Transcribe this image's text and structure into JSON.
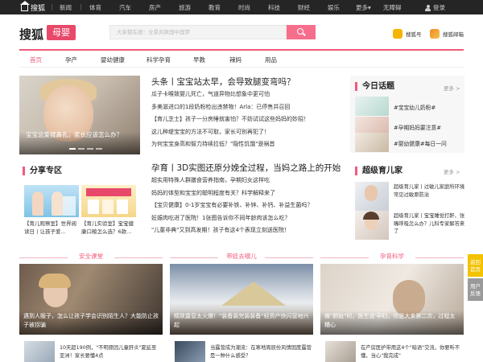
{
  "topbar": {
    "logo": "搜狐",
    "nav": [
      "新闻",
      "体育",
      "汽车",
      "房产",
      "旅游",
      "教育",
      "时尚",
      "科技",
      "财经",
      "娱乐",
      "更多",
      "无障碍"
    ],
    "more_arrow": "▾",
    "login": "登录"
  },
  "header": {
    "brand": "搜狐",
    "brand_sub": "母婴",
    "search_placeholder": "大家都在搜：全景风致国中国梦",
    "links": [
      {
        "label": "搜狐号",
        "color": "#f5b400"
      },
      {
        "label": "搜狐邮箱",
        "color": "#f08a24"
      }
    ]
  },
  "subnav": {
    "items": [
      "首页",
      "孕产",
      "婴幼健康",
      "科学孕育",
      "早教",
      "辣妈",
      "用品"
    ],
    "active_index": 0,
    "accent": "#f05b7a"
  },
  "hero": {
    "caption": "宝宝总爱揉鼻孔，家长应该怎么办？"
  },
  "headlines": {
    "group1": {
      "title": "头条丨宝宝站太早，会导致腿变弯吗？",
      "items": [
        "瓜子卡喉致婴儿死亡，气道异物比想象中更可怕",
        "多美滋进口的1段奶粉检出违禁物！Arla：已停售并召回",
        "【育儿芝士】孩子一分房睡就害怕？不妨试试这些妈妈的妙招！",
        "这儿种堤宝宝的方法不可取，家长可别再犯了！",
        "为何宝宝身高和智力持续拉低？\"隐性饥饿\"是祸首"
      ]
    },
    "group2": {
      "title": "孕育丨3D实图还原分娩全过程，当妈之路上的开始",
      "items": [
        "超实用特殊人群膳食营养指南，孕期妇女这样吃",
        "妈妈的体型和宝宝的聪明程度有关？科学解释来了",
        "【宝贝健康】0-1岁宝宝有必要补铁、补锌、补钙、补益生菌吗？",
        "妊娠肉吃进了医院！1张图告诉你不同年龄肉该怎么吃？",
        "\"儿童非典\"又到高发期！孩子有这4个表现立刻送医院！"
      ]
    }
  },
  "share": {
    "title": "分享专区",
    "cards": [
      {
        "caption": "【育儿观察室】世界阅读日丨让孩子爱..."
      },
      {
        "caption": "【育儿实验室】宝宝健康口粮怎么选？6款..."
      }
    ]
  },
  "today_topics": {
    "title": "今日话题",
    "more": "更多 >",
    "items": [
      "#宝宝幼儿奶粉#",
      "#孕期妈妈要注意#",
      "#婴幼健康#每日一问"
    ]
  },
  "super_parent": {
    "title": "超级育儿家",
    "more": "更多 >",
    "items": [
      "超级育儿家丨过敏儿家庭所环境常见过敏原防治",
      "超级育儿家丨宝宝睡觉打鼾、张嘴呼吸怎么办？儿科专家解答来了"
    ]
  },
  "bottom": {
    "sections": [
      {
        "title": "安全课堂",
        "caption": "遇到人贩子，怎么让孩子学会识别陌生人？大能防止孩子被拐骗",
        "thumb_text": "10天超190例，\"不明原因儿童肝炎\"夏延至亚洲！家长要懂4点"
      },
      {
        "title": "带娃去哪儿",
        "caption": "精致露营太火爆！\"装备装完装装备\"轻资产快闪营地兴起",
        "thumb_text": "当露营成为潮流：在寒地周辰份风情国度露营是一种什么感受？"
      },
      {
        "title": "孕育科学",
        "caption": "做\"胆趾\"时，医生说'孕妇，你是大来第二次，过程太糟心",
        "thumb_text": "在产房医护带用这4个\"暗语\"交流，你要听不懂，当心\"我完成\""
      }
    ]
  },
  "float_buttons": [
    {
      "label": "返回首页",
      "color": "#f3c200"
    },
    {
      "label": "用户反馈",
      "color": "#9a9a9a"
    }
  ]
}
